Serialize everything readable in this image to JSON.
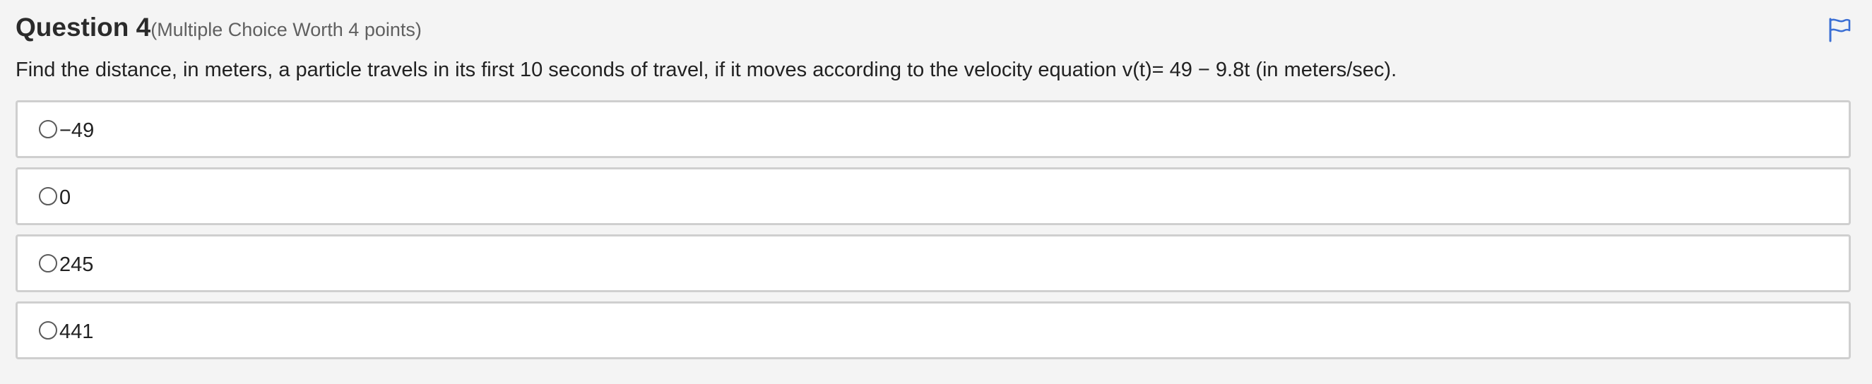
{
  "question": {
    "title": "Question 4",
    "meta": "(Multiple Choice Worth 4 points)",
    "prompt": "Find the distance, in meters, a particle travels in its first 10 seconds of travel, if it moves according to the velocity equation v(t)= 49 − 9.8t (in meters/sec).",
    "flag_icon": "flag-icon",
    "accent_color": "#3b6fd4",
    "options": [
      {
        "label": "−49",
        "selected": false
      },
      {
        "label": "0",
        "selected": false
      },
      {
        "label": "245",
        "selected": false
      },
      {
        "label": "441",
        "selected": false
      }
    ]
  }
}
